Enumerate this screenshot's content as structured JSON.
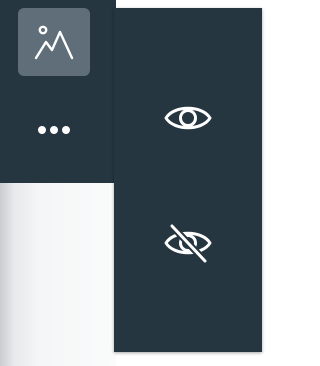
{
  "toolbar": {
    "terrain_button": {
      "icon": "terrain-mountain-icon",
      "active": true
    },
    "more_button": {
      "icon": "more-horizontal-icon"
    }
  },
  "visibility_menu": {
    "items": [
      {
        "id": "show",
        "icon": "eye-icon"
      },
      {
        "id": "hide",
        "icon": "eye-slash-icon"
      }
    ]
  },
  "colors": {
    "panel_bg": "#253640",
    "active_button_bg": "#5f6e78",
    "icon_color": "#ffffff"
  }
}
